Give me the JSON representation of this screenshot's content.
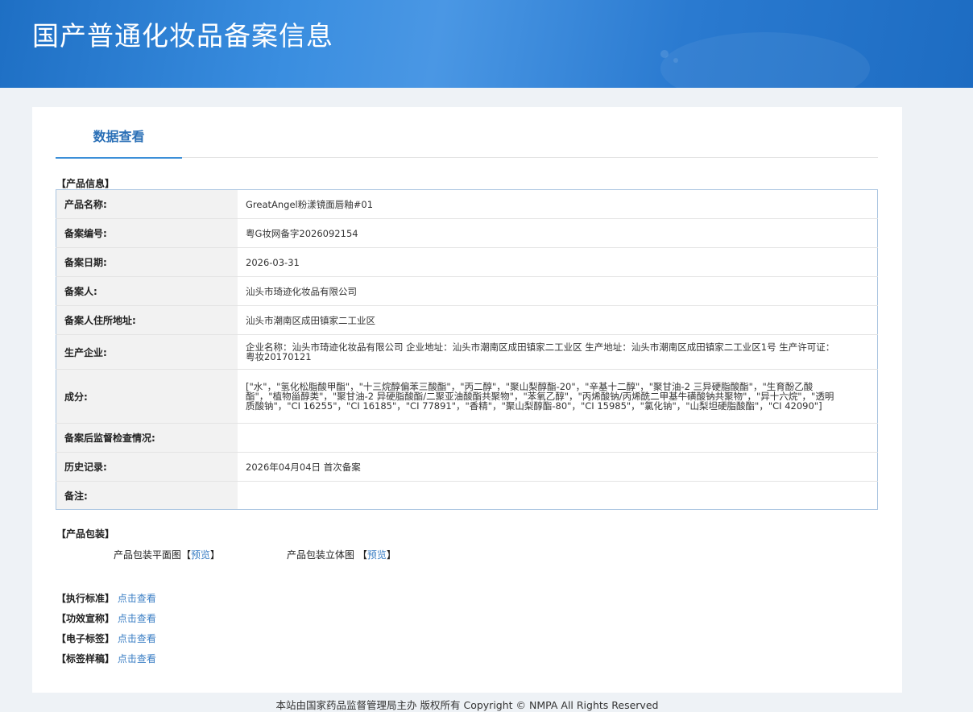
{
  "page_title": "国产普通化妆品备案信息",
  "tab": "数据查看",
  "product_info_title": "【产品信息】",
  "rows": [
    {
      "label": "产品名称:",
      "value": "GreatAngel粉漾镜面唇釉#01"
    },
    {
      "label": "备案编号:",
      "value": "粤G妆网备字2026092154"
    },
    {
      "label": "备案日期:",
      "value": "2026-03-31"
    },
    {
      "label": "备案人:",
      "value": "汕头市琦迹化妆品有限公司"
    },
    {
      "label": "备案人住所地址:",
      "value": "汕头市潮南区成田镇家二工业区"
    },
    {
      "label": "生产企业:",
      "value": "企业名称：汕头市琦迹化妆品有限公司 企业地址：汕头市潮南区成田镇家二工业区 生产地址：汕头市潮南区成田镇家二工业区1号 生产许可证：粤妆20170121"
    },
    {
      "label": "成分:",
      "value": "[\"水\"，\"氢化松脂酸甲酯\"，\"十三烷醇偏苯三酸酯\"，\"丙二醇\"，\"聚山梨醇酯-20\"，\"辛基十二醇\"，\"聚甘油-2 三异硬脂酸酯\"，\"生育酚乙酸酯\"，\"植物甾醇类\"，\"聚甘油-2 异硬脂酸酯/二聚亚油酸酯共聚物\"，\"苯氧乙醇\"，\"丙烯酸钠/丙烯酰二甲基牛磺酸钠共聚物\"，\"异十六烷\"，\"透明质酸钠\"，\"CI 16255\"，\"CI 16185\"，\"CI 77891\"，\"香精\"，\"聚山梨醇酯-80\"，\"CI 15985\"，\"氯化钠\"，\"山梨坦硬脂酸酯\"，\"CI 42090\"]"
    },
    {
      "label": "备案后监督检查情况:",
      "value": ""
    },
    {
      "label": "历史记录:",
      "value": "2026年04月04日 首次备案"
    },
    {
      "label": "备注:",
      "value": ""
    }
  ],
  "packaging": {
    "title": "【产品包装】",
    "flat_label": "产品包装平面图",
    "solid_label": "产品包装立体图",
    "bracket_open": "【",
    "bracket_close": "】",
    "preview": "预览"
  },
  "links": [
    {
      "label": "【执行标准】",
      "link": "点击查看"
    },
    {
      "label": "【功效宣称】",
      "link": "点击查看"
    },
    {
      "label": "【电子标签】",
      "link": "点击查看"
    },
    {
      "label": "【标签样稿】",
      "link": "点击查看"
    }
  ],
  "footer": "本站由国家药品监督管理局主办 版权所有 Copyright © NMPA All Rights Reserved"
}
